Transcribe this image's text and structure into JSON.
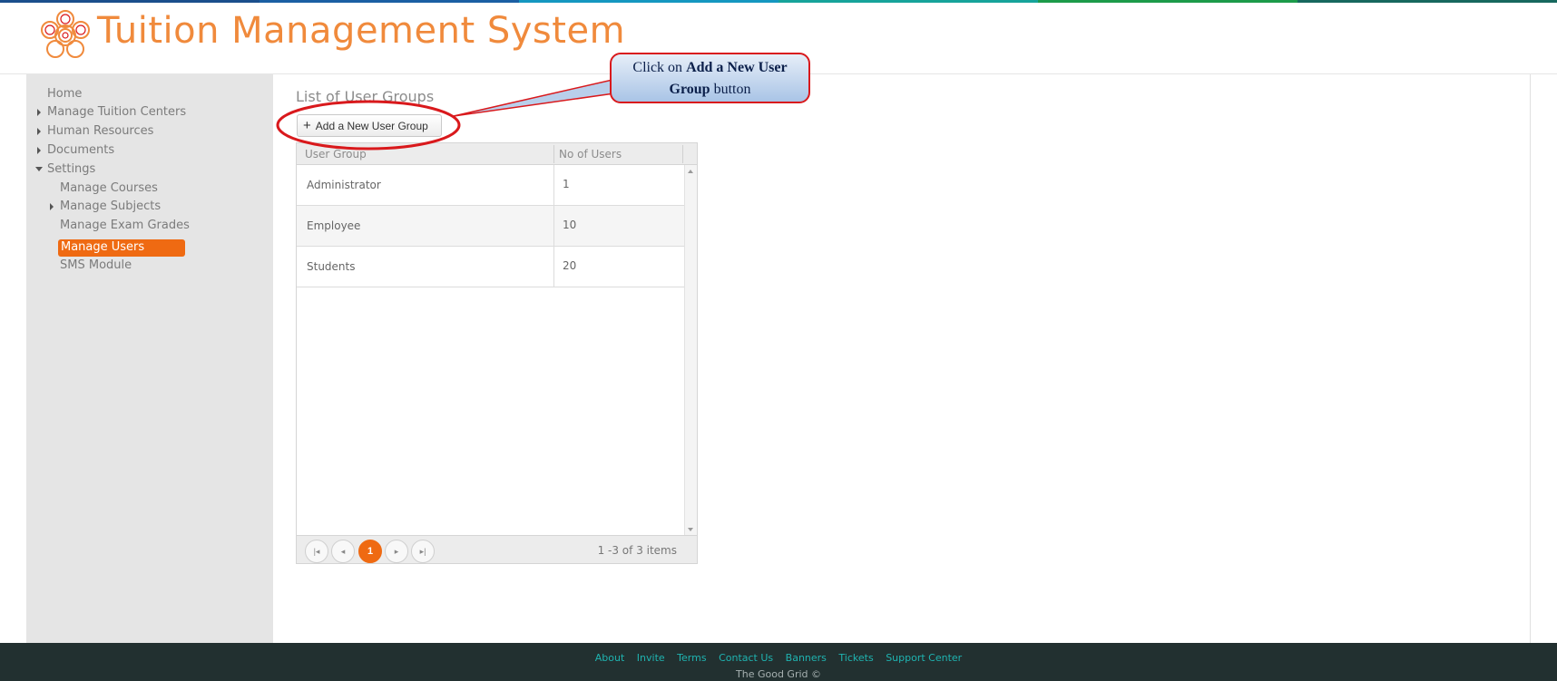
{
  "app": {
    "title": "Tuition Management System"
  },
  "colors": {
    "brand_orange": "#f08a3c",
    "active_nav": "#ef6a12",
    "footer_bg": "#223030",
    "footer_link": "#1fb3b0",
    "callout_border": "#d9191c",
    "stripe": [
      "#1b4f8c",
      "#1b5fa3",
      "#1597c0",
      "#16a39a",
      "#1c9b4a",
      "#17685e"
    ]
  },
  "sidebar": {
    "items": [
      {
        "label": "Home",
        "icon": ""
      },
      {
        "label": "Manage Tuition Centers",
        "icon": "caret-right-icon"
      },
      {
        "label": "Human Resources",
        "icon": "caret-right-icon"
      },
      {
        "label": "Documents",
        "icon": "caret-right-icon"
      },
      {
        "label": "Settings",
        "icon": "caret-down-icon"
      },
      {
        "label": "Manage Courses",
        "icon": ""
      },
      {
        "label": "Manage Subjects",
        "icon": "caret-right-icon"
      },
      {
        "label": "Manage Exam Grades",
        "icon": ""
      },
      {
        "label": "Manage Users",
        "icon": "",
        "active": true
      },
      {
        "label": "SMS Module",
        "icon": ""
      }
    ]
  },
  "main": {
    "page_title": "List of User Groups",
    "add_button_label": "Add a New User Group",
    "grid": {
      "columns": [
        "User Group",
        "No of Users"
      ],
      "rows": [
        [
          "Administrator",
          "1"
        ],
        [
          "Employee",
          "10"
        ],
        [
          "Students",
          "20"
        ]
      ],
      "pager": {
        "current_page": "1",
        "info": "1 -3 of 3 items"
      }
    }
  },
  "callout": {
    "prefix": "Click on ",
    "bold": "Add a New User Group",
    "suffix": " button"
  },
  "footer": {
    "links": [
      "About",
      "Invite",
      "Terms",
      "Contact Us",
      "Banners",
      "Tickets",
      "Support Center"
    ],
    "copyright": "The Good Grid ©"
  }
}
